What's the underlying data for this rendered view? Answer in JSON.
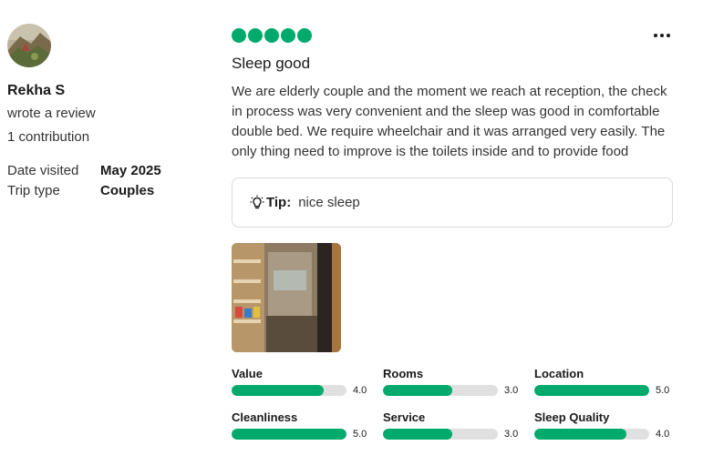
{
  "reviewer": {
    "name": "Rekha S",
    "action": "wrote a review",
    "contributions": "1 contribution",
    "date_visited_label": "Date visited",
    "date_visited": "May 2025",
    "trip_type_label": "Trip type",
    "trip_type": "Couples"
  },
  "review": {
    "bubble_rating": 5,
    "title": "Sleep good",
    "text": "We are elderly couple and the moment we reach at reception, the check in process was very convenient and the sleep was good in comfortable double bed. We require wheelchair and it was arranged very easily. The only thing need to improve is the toilets inside and to provide food",
    "tip_label": "Tip:",
    "tip_text": "nice sleep"
  },
  "ratings": [
    {
      "name": "Value",
      "value": "4.0",
      "fraction": 0.8
    },
    {
      "name": "Rooms",
      "value": "3.0",
      "fraction": 0.6
    },
    {
      "name": "Location",
      "value": "5.0",
      "fraction": 1.0
    },
    {
      "name": "Cleanliness",
      "value": "5.0",
      "fraction": 1.0
    },
    {
      "name": "Service",
      "value": "3.0",
      "fraction": 0.6
    },
    {
      "name": "Sleep Quality",
      "value": "4.0",
      "fraction": 0.8
    }
  ],
  "colors": {
    "accent": "#00aa6c",
    "bar_track": "#e0e0e0"
  },
  "icons": {
    "more": "more-options-icon",
    "tip": "lightbulb-icon"
  }
}
